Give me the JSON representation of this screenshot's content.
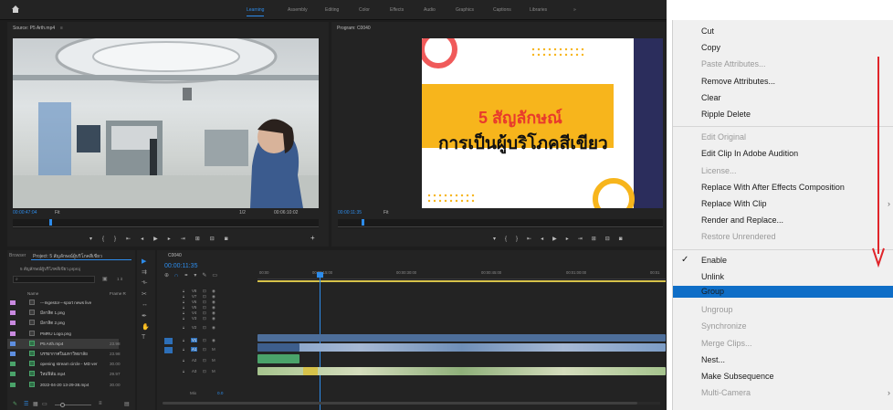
{
  "workspaces": {
    "items": [
      "Learning",
      "Assembly",
      "Editing",
      "Color",
      "Effects",
      "Audio",
      "Graphics",
      "Captions",
      "Libraries"
    ],
    "more": "»"
  },
  "source_monitor": {
    "title": "Source: P5 Arth.mp4",
    "timecode": "00:00:47:04",
    "fit": "Fit",
    "ratio": "1/2",
    "duration": "00:06:10:02"
  },
  "program_monitor": {
    "title": "Program: C0040",
    "timecode": "00:00:11:35",
    "fit": "Fit",
    "overlay_heading": "5 สัญลักษณ์",
    "overlay_sub": "การเป็นผู้บริโภคสีเขียว"
  },
  "project_panel": {
    "tabs": [
      "Browser",
      "Project: 5 สัญลักษณ์ผู้บริโภคสีเขียว"
    ],
    "path": "5 สัญลักษณ์ผู้บริโภคสีเขียว.prproj",
    "col_name": "Name",
    "col_rate": "Frame R",
    "item_count": "1 it",
    "items": [
      {
        "name": "---Ingestor---sport news live",
        "rate": "",
        "swatch": "#c98ae0",
        "type": "file"
      },
      {
        "name": "มีลาสิต 1.png",
        "rate": "",
        "swatch": "#c98ae0",
        "type": "file"
      },
      {
        "name": "มีลาสิต 2.png",
        "rate": "",
        "swatch": "#c98ae0",
        "type": "file"
      },
      {
        "name": "PMRU Logo.png",
        "rate": "",
        "swatch": "#c98ae0",
        "type": "file"
      },
      {
        "name": "P5 Arth.mp4",
        "rate": "23.98",
        "swatch": "#5e8fe0",
        "type": "video"
      },
      {
        "name": "บรรยากาศในมหาวิทยาลัย",
        "rate": "23.98",
        "swatch": "#5e8fe0",
        "type": "video"
      },
      {
        "name": "opening stream circle - MD ver",
        "rate": "30.00",
        "swatch": "#4aa36a",
        "type": "video"
      },
      {
        "name": "ใหม่ฟิล์ม.mp4",
        "rate": "29.97",
        "swatch": "#4aa36a",
        "type": "video"
      },
      {
        "name": "2022-04-20 13-29-38.mp4",
        "rate": "30.00",
        "swatch": "#4aa36a",
        "type": "video"
      }
    ]
  },
  "timeline": {
    "tab": "C0040",
    "timecode": "00:00:11:35",
    "ruler": [
      "00:00",
      "00:00:15:00",
      "00:00:30:00",
      "00:00:45:00",
      "00:01:00:00",
      "00:01"
    ],
    "tracks": [
      "V8",
      "V7",
      "V6",
      "V5",
      "V4",
      "V3",
      "V2",
      "V1",
      "A1",
      "A2",
      "A3"
    ],
    "mix": "Mix",
    "mix_value": "0.0"
  },
  "context_menu": {
    "items": [
      {
        "label": "Cut",
        "enabled": true
      },
      {
        "label": "Copy",
        "enabled": true
      },
      {
        "label": "Paste Attributes...",
        "enabled": false
      },
      {
        "label": "Remove Attributes...",
        "enabled": true
      },
      {
        "label": "Clear",
        "enabled": true
      },
      {
        "label": "Ripple Delete",
        "enabled": true
      },
      {
        "sep": true
      },
      {
        "label": "Edit Original",
        "enabled": false
      },
      {
        "label": "Edit Clip In Adobe Audition",
        "enabled": true
      },
      {
        "label": "License...",
        "enabled": false
      },
      {
        "label": "Replace With After Effects Composition",
        "enabled": true
      },
      {
        "label": "Replace With Clip",
        "enabled": true,
        "submenu": true
      },
      {
        "label": "Render and Replace...",
        "enabled": true
      },
      {
        "label": "Restore Unrendered",
        "enabled": false
      },
      {
        "sep": true
      },
      {
        "label": "Enable",
        "enabled": true,
        "checked": true
      },
      {
        "label": "Unlink",
        "enabled": true
      },
      {
        "label": "Group",
        "enabled": true,
        "highlighted": true
      },
      {
        "label": "Ungroup",
        "enabled": false
      },
      {
        "label": "Synchronize",
        "enabled": false
      },
      {
        "label": "Merge Clips...",
        "enabled": false
      },
      {
        "label": "Nest...",
        "enabled": true
      },
      {
        "label": "Make Subsequence",
        "enabled": true
      },
      {
        "label": "Multi-Camera",
        "enabled": false,
        "submenu": true
      }
    ],
    "checkmark": "✓",
    "submenu_chevron": "›",
    "highlight_color": "#0f6ec7",
    "annotation_color": "#e0242a"
  }
}
